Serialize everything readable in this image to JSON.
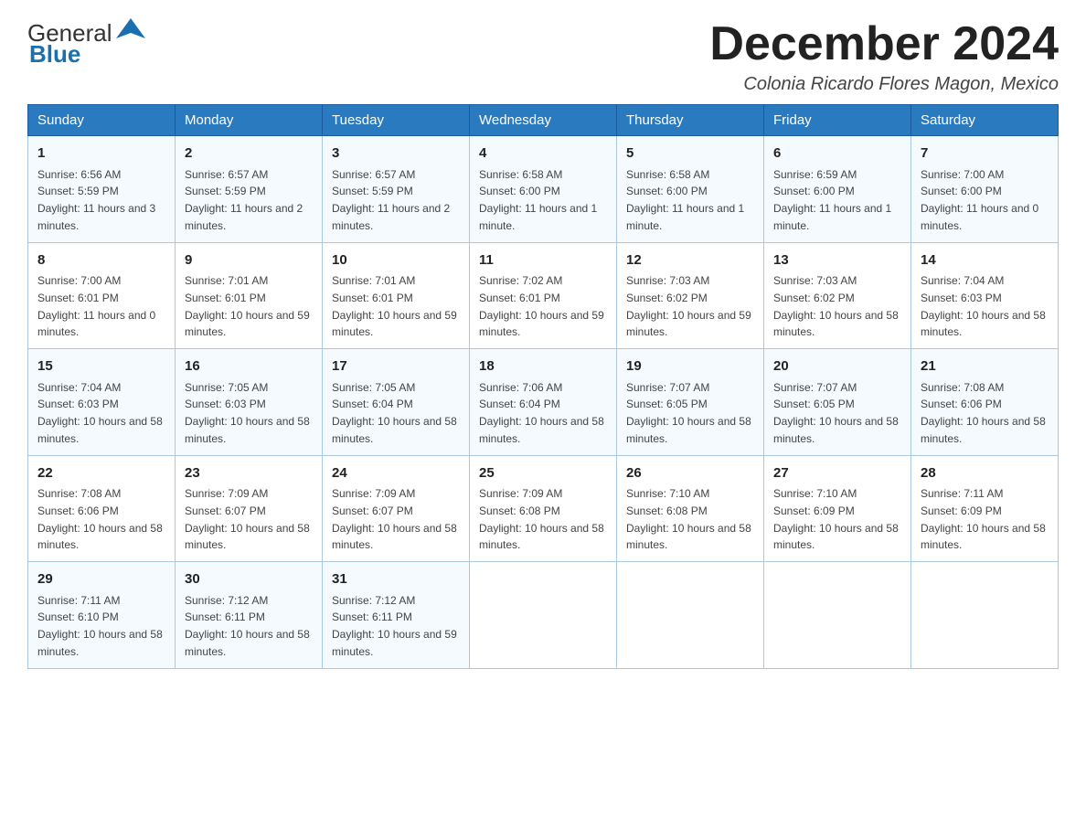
{
  "header": {
    "logo_text_general": "General",
    "logo_text_blue": "Blue",
    "month_title": "December 2024",
    "location": "Colonia Ricardo Flores Magon, Mexico"
  },
  "weekdays": [
    "Sunday",
    "Monday",
    "Tuesday",
    "Wednesday",
    "Thursday",
    "Friday",
    "Saturday"
  ],
  "weeks": [
    [
      {
        "day": "1",
        "sunrise": "6:56 AM",
        "sunset": "5:59 PM",
        "daylight": "11 hours and 3 minutes."
      },
      {
        "day": "2",
        "sunrise": "6:57 AM",
        "sunset": "5:59 PM",
        "daylight": "11 hours and 2 minutes."
      },
      {
        "day": "3",
        "sunrise": "6:57 AM",
        "sunset": "5:59 PM",
        "daylight": "11 hours and 2 minutes."
      },
      {
        "day": "4",
        "sunrise": "6:58 AM",
        "sunset": "6:00 PM",
        "daylight": "11 hours and 1 minute."
      },
      {
        "day": "5",
        "sunrise": "6:58 AM",
        "sunset": "6:00 PM",
        "daylight": "11 hours and 1 minute."
      },
      {
        "day": "6",
        "sunrise": "6:59 AM",
        "sunset": "6:00 PM",
        "daylight": "11 hours and 1 minute."
      },
      {
        "day": "7",
        "sunrise": "7:00 AM",
        "sunset": "6:00 PM",
        "daylight": "11 hours and 0 minutes."
      }
    ],
    [
      {
        "day": "8",
        "sunrise": "7:00 AM",
        "sunset": "6:01 PM",
        "daylight": "11 hours and 0 minutes."
      },
      {
        "day": "9",
        "sunrise": "7:01 AM",
        "sunset": "6:01 PM",
        "daylight": "10 hours and 59 minutes."
      },
      {
        "day": "10",
        "sunrise": "7:01 AM",
        "sunset": "6:01 PM",
        "daylight": "10 hours and 59 minutes."
      },
      {
        "day": "11",
        "sunrise": "7:02 AM",
        "sunset": "6:01 PM",
        "daylight": "10 hours and 59 minutes."
      },
      {
        "day": "12",
        "sunrise": "7:03 AM",
        "sunset": "6:02 PM",
        "daylight": "10 hours and 59 minutes."
      },
      {
        "day": "13",
        "sunrise": "7:03 AM",
        "sunset": "6:02 PM",
        "daylight": "10 hours and 58 minutes."
      },
      {
        "day": "14",
        "sunrise": "7:04 AM",
        "sunset": "6:03 PM",
        "daylight": "10 hours and 58 minutes."
      }
    ],
    [
      {
        "day": "15",
        "sunrise": "7:04 AM",
        "sunset": "6:03 PM",
        "daylight": "10 hours and 58 minutes."
      },
      {
        "day": "16",
        "sunrise": "7:05 AM",
        "sunset": "6:03 PM",
        "daylight": "10 hours and 58 minutes."
      },
      {
        "day": "17",
        "sunrise": "7:05 AM",
        "sunset": "6:04 PM",
        "daylight": "10 hours and 58 minutes."
      },
      {
        "day": "18",
        "sunrise": "7:06 AM",
        "sunset": "6:04 PM",
        "daylight": "10 hours and 58 minutes."
      },
      {
        "day": "19",
        "sunrise": "7:07 AM",
        "sunset": "6:05 PM",
        "daylight": "10 hours and 58 minutes."
      },
      {
        "day": "20",
        "sunrise": "7:07 AM",
        "sunset": "6:05 PM",
        "daylight": "10 hours and 58 minutes."
      },
      {
        "day": "21",
        "sunrise": "7:08 AM",
        "sunset": "6:06 PM",
        "daylight": "10 hours and 58 minutes."
      }
    ],
    [
      {
        "day": "22",
        "sunrise": "7:08 AM",
        "sunset": "6:06 PM",
        "daylight": "10 hours and 58 minutes."
      },
      {
        "day": "23",
        "sunrise": "7:09 AM",
        "sunset": "6:07 PM",
        "daylight": "10 hours and 58 minutes."
      },
      {
        "day": "24",
        "sunrise": "7:09 AM",
        "sunset": "6:07 PM",
        "daylight": "10 hours and 58 minutes."
      },
      {
        "day": "25",
        "sunrise": "7:09 AM",
        "sunset": "6:08 PM",
        "daylight": "10 hours and 58 minutes."
      },
      {
        "day": "26",
        "sunrise": "7:10 AM",
        "sunset": "6:08 PM",
        "daylight": "10 hours and 58 minutes."
      },
      {
        "day": "27",
        "sunrise": "7:10 AM",
        "sunset": "6:09 PM",
        "daylight": "10 hours and 58 minutes."
      },
      {
        "day": "28",
        "sunrise": "7:11 AM",
        "sunset": "6:09 PM",
        "daylight": "10 hours and 58 minutes."
      }
    ],
    [
      {
        "day": "29",
        "sunrise": "7:11 AM",
        "sunset": "6:10 PM",
        "daylight": "10 hours and 58 minutes."
      },
      {
        "day": "30",
        "sunrise": "7:12 AM",
        "sunset": "6:11 PM",
        "daylight": "10 hours and 58 minutes."
      },
      {
        "day": "31",
        "sunrise": "7:12 AM",
        "sunset": "6:11 PM",
        "daylight": "10 hours and 59 minutes."
      },
      null,
      null,
      null,
      null
    ]
  ]
}
